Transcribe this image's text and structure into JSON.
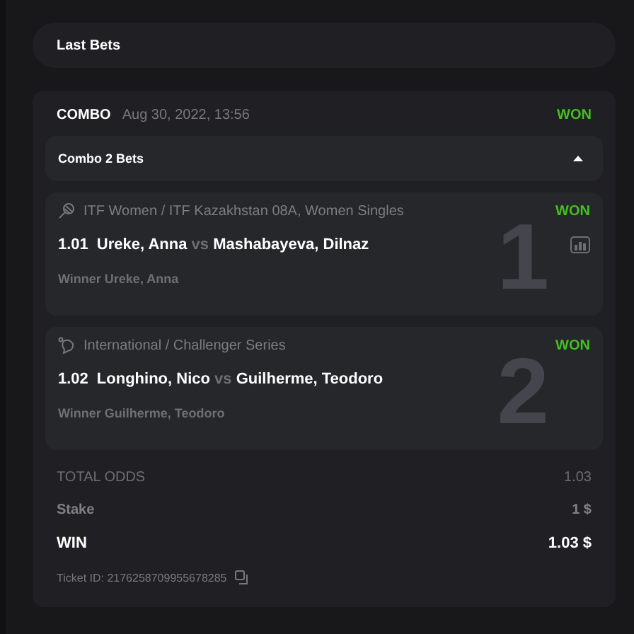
{
  "header": {
    "title": "Last Bets"
  },
  "bet": {
    "type": "COMBO",
    "date": "Aug 30, 2022, 13:56",
    "status": "WON",
    "combo": {
      "title": "Combo 2 Bets",
      "expanded": true
    },
    "legs": [
      {
        "kind": "tennis",
        "league": "ITF Women / ITF Kazakhstan 08A, Women Singles",
        "status": "WON",
        "odds": "1.01",
        "home": "Ureke, Anna",
        "vs": "vs",
        "away": "Mashabayeva, Dilnaz",
        "selection": "Winner Ureke, Anna",
        "number": "1",
        "has_stats": true
      },
      {
        "kind": "ball",
        "league": "International / Challenger Series",
        "status": "WON",
        "odds": "1.02",
        "home": "Longhino, Nico",
        "vs": "vs",
        "away": "Guilherme, Teodoro",
        "selection": "Winner Guilherme, Teodoro",
        "number": "2",
        "has_stats": false
      }
    ],
    "summary": [
      {
        "kind": "odds",
        "label": "TOTAL ODDS",
        "value": "1.03"
      },
      {
        "kind": "stake",
        "label": "Stake",
        "value": "1 $"
      },
      {
        "kind": "win",
        "label": "WIN",
        "value": "1.03 $"
      }
    ],
    "ticket": "Ticket ID: 2176258709955678285"
  }
}
